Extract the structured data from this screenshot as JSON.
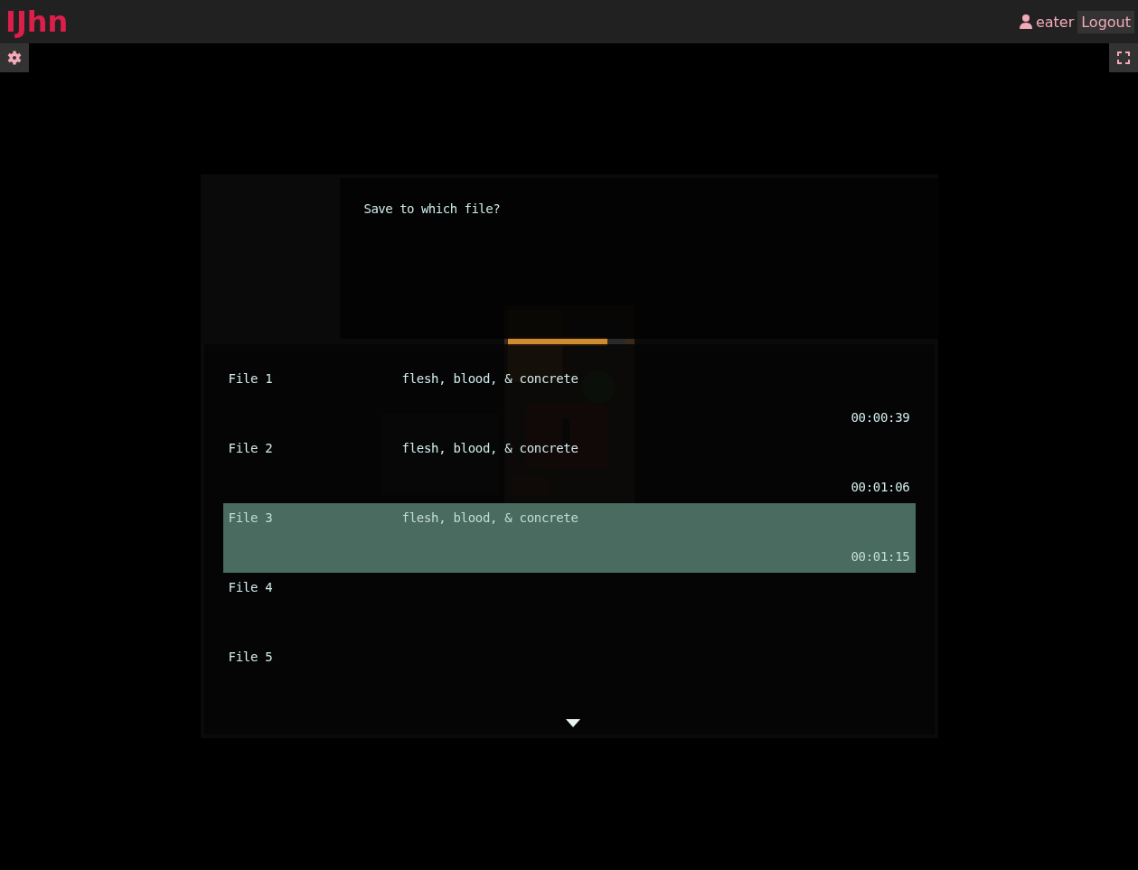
{
  "header": {
    "logo": "IJhn",
    "user": "eater",
    "logout": "Logout"
  },
  "game": {
    "message": "Save to which file?",
    "more_below": true,
    "files": [
      {
        "label": "File 1",
        "title": "flesh, blood, & concrete",
        "time": "00:00:39",
        "selected": false
      },
      {
        "label": "File 2",
        "title": "flesh, blood, & concrete",
        "time": "00:01:06",
        "selected": false
      },
      {
        "label": "File 3",
        "title": "flesh, blood, & concrete",
        "time": "00:01:15",
        "selected": true
      },
      {
        "label": "File 4",
        "selected": false
      },
      {
        "label": "File 5",
        "selected": false
      }
    ]
  }
}
